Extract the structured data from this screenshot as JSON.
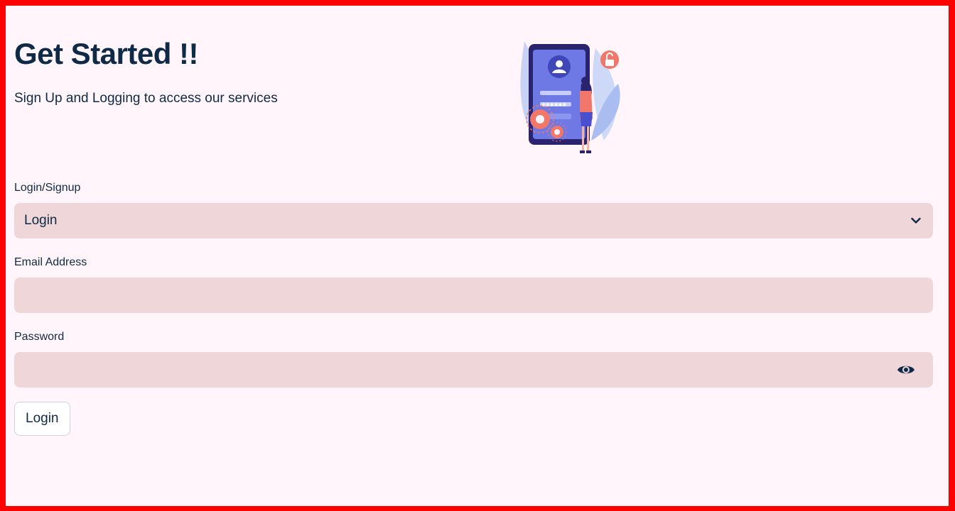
{
  "header": {
    "title": "Get Started !!",
    "subtitle": "Sign Up and Logging to access our services"
  },
  "form": {
    "mode_label": "Login/Signup",
    "mode_selected": "Login",
    "email_label": "Email Address",
    "email_value": "",
    "password_label": "Password",
    "password_value": "",
    "submit_label": "Login"
  },
  "icons": {
    "mode_dropdown": "chevron-down-icon",
    "password_toggle": "eye-icon",
    "hero": "login-illustration"
  },
  "colors": {
    "page_border": "#ff0000",
    "background": "#fff5fa",
    "text": "#0f2a47",
    "field_background": "#efd6d8",
    "button_border": "#cdd3dc"
  }
}
